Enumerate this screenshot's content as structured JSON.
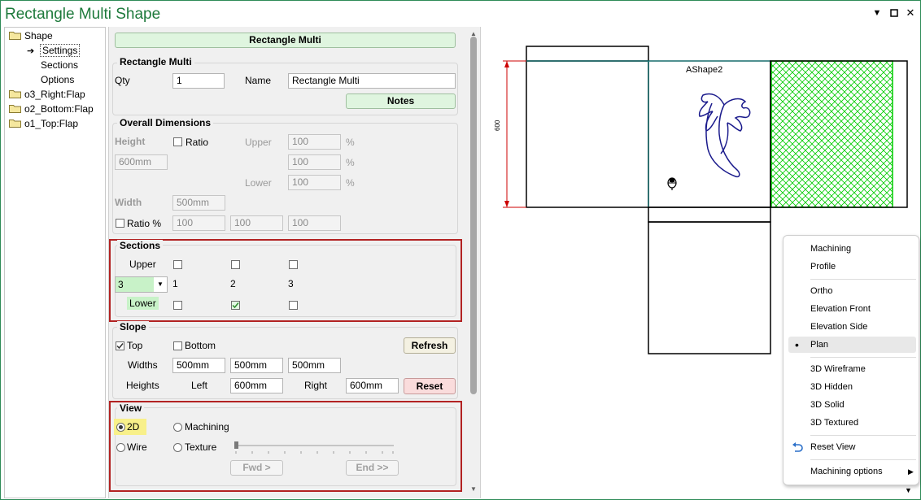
{
  "window": {
    "title": "Rectangle Multi Shape"
  },
  "tree": {
    "items": [
      {
        "label": "Shape"
      },
      {
        "label": "Settings"
      },
      {
        "label": "Sections"
      },
      {
        "label": "Options"
      },
      {
        "label": "o3_Right:Flap"
      },
      {
        "label": "o2_Bottom:Flap"
      },
      {
        "label": "o1_Top:Flap"
      }
    ]
  },
  "panel": {
    "header_button": "Rectangle Multi",
    "rect_group": {
      "title": "Rectangle Multi",
      "qty_label": "Qty",
      "qty_value": "1",
      "name_label": "Name",
      "name_value": "Rectangle Multi",
      "notes_button": "Notes"
    },
    "overall": {
      "title": "Overall Dimensions",
      "height_label": "Height",
      "ratio_label": "Ratio",
      "upper_label": "Upper",
      "lower_label": "Lower",
      "pct": "%",
      "height_value": "600mm",
      "r1": "100",
      "r2": "100",
      "r3": "100",
      "width_label": "Width",
      "width_value": "500mm",
      "ratio_pct_label": "Ratio %",
      "w1": "100",
      "w2": "100",
      "w3": "100"
    },
    "sections": {
      "title": "Sections",
      "upper_label": "Upper",
      "lower_label": "Lower",
      "count_value": "3",
      "col_labels": [
        "1",
        "2",
        "3"
      ]
    },
    "slope": {
      "title": "Slope",
      "top_label": "Top",
      "bottom_label": "Bottom",
      "refresh_button": "Refresh",
      "widths_label": "Widths",
      "widths": [
        "500mm",
        "500mm",
        "500mm"
      ],
      "heights_label": "Heights",
      "left_label": "Left",
      "left_value": "600mm",
      "right_label": "Right",
      "right_value": "600mm",
      "reset_button": "Reset"
    },
    "view": {
      "title": "View",
      "opt_2d": "2D",
      "opt_machining": "Machining",
      "opt_wire": "Wire",
      "opt_texture": "Texture",
      "fwd_button": "Fwd >",
      "end_button": "End >>"
    }
  },
  "drawing": {
    "shape_label": "AShape2",
    "dimension": "600"
  },
  "context_menu": {
    "items": [
      "Machining",
      "Profile",
      "Ortho",
      "Elevation Front",
      "Elevation Side",
      "Plan",
      "3D Wireframe",
      "3D Hidden",
      "3D Solid",
      "3D Textured",
      "Reset View",
      "Machining options"
    ],
    "selected": "Plan"
  },
  "colors": {
    "accent_green": "#1e7a3c",
    "frame_red": "#b22222",
    "hatch_green": "#00cc00"
  }
}
